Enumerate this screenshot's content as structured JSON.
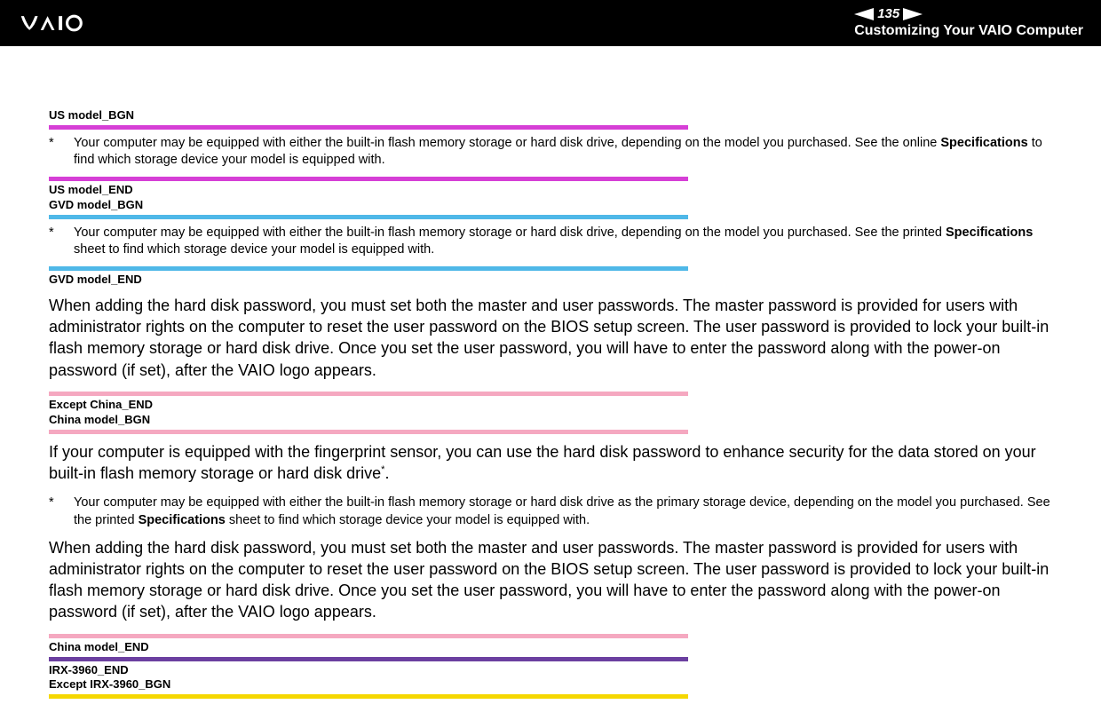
{
  "header": {
    "page_number": "135",
    "title": "Customizing Your VAIO Computer"
  },
  "markers": {
    "us_bgn": "US model_BGN",
    "us_end": "US model_END",
    "gvd_bgn": "GVD model_BGN",
    "gvd_end": "GVD model_END",
    "except_china_end": "Except China_END",
    "china_bgn": "China model_BGN",
    "china_end": "China model_END",
    "irx_end": "IRX-3960_END",
    "except_irx_bgn": "Except IRX-3960_BGN"
  },
  "notes": {
    "ast": "*",
    "us_note_pre": "Your computer may be equipped with either the built-in flash memory storage or hard disk drive, depending on the model you purchased. See the online ",
    "us_note_bold": "Specifications",
    "us_note_post": " to find which storage device your model is equipped with.",
    "gvd_note_pre": "Your computer may be equipped with either the built-in flash memory storage or hard disk drive, depending on the model you purchased. See the printed ",
    "gvd_note_bold": "Specifications",
    "gvd_note_post": " sheet to find which storage device your model is equipped with.",
    "china_note_pre": "Your computer may be equipped with either the built-in flash memory storage or hard disk drive as the primary storage device, depending on the model you purchased. See the printed ",
    "china_note_bold": "Specifications",
    "china_note_post": " sheet to find which storage device your model is equipped with."
  },
  "body": {
    "master_user": "When adding the hard disk password, you must set both the master and user passwords. The master password is provided for users with administrator rights on the computer to reset the user password on the BIOS setup screen. The user password is provided to lock your built-in flash memory storage or hard disk drive. Once you set the user password, you will have to enter the password along with the power-on password (if set), after the VAIO logo appears.",
    "fingerprint_pre": "If your computer is equipped with the fingerprint sensor, you can use the hard disk password to enhance security for the data stored on your built-in flash memory storage or hard disk drive",
    "fingerprint_sup": "*",
    "fingerprint_post": "."
  }
}
